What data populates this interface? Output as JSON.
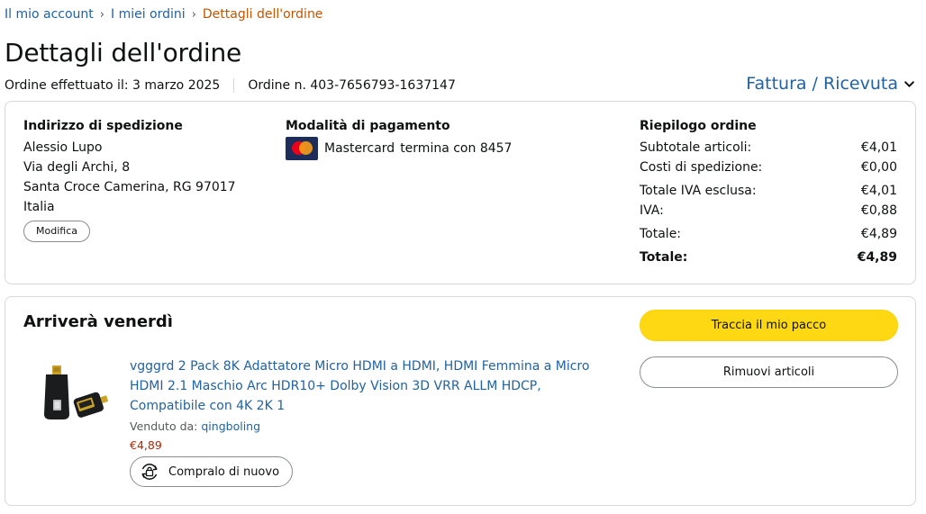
{
  "breadcrumb": {
    "account": "Il mio account",
    "orders": "I miei ordini",
    "current": "Dettagli dell'ordine",
    "separator": "›"
  },
  "page_title": "Dettagli dell'ordine",
  "order_meta": {
    "placed": "Ordine effettuato il: 3 marzo 2025",
    "number": "Ordine n. 403-7656793-1637147"
  },
  "invoice_link": "Fattura / Ricevuta",
  "shipping": {
    "title": "Indirizzo di spedizione",
    "name": "Alessio Lupo",
    "street": "Via degli Archi, 8",
    "city": "Santa Croce Camerina, RG 97017",
    "country": "Italia",
    "edit_label": "Modifica"
  },
  "payment": {
    "title": "Modalità di pagamento",
    "card_brand": "Mastercard",
    "card_ending": "termina con 8457",
    "card_icon": "mastercard-icon"
  },
  "summary": {
    "title": "Riepilogo ordine",
    "rows": [
      {
        "label": "Subtotale articoli:",
        "value": "€4,01"
      },
      {
        "label": "Costi di spedizione:",
        "value": "€0,00"
      },
      {
        "label": "Totale IVA esclusa:",
        "value": "€4,01"
      },
      {
        "label": "IVA:",
        "value": "€0,88"
      },
      {
        "label": "Totale:",
        "value": "€4,89"
      },
      {
        "label": "Totale:",
        "value": "€4,89"
      }
    ]
  },
  "shipment": {
    "arrival": "Arriverà venerdì",
    "track_label": "Traccia il mio pacco",
    "remove_label": "Rimuovi articoli",
    "product": {
      "title": "vgggrd 2 Pack 8K Adattatore Micro HDMI a HDMI, HDMI Femmina a Micro HDMI 2.1 Maschio Arc HDR10+ Dolby Vision 3D VRR ALLM HDCP, Compatibile con 4K 2K 1",
      "sold_by_label": "Venduto da:",
      "seller": "qingboling",
      "price": "€4,89",
      "buy_again_label": "Compralo di nuovo"
    }
  },
  "colors": {
    "link": "#2162a1",
    "breadcrumb_current": "#c45500",
    "price": "#b12704",
    "primary_button": "#ffd814",
    "border": "#d5d9d9"
  }
}
